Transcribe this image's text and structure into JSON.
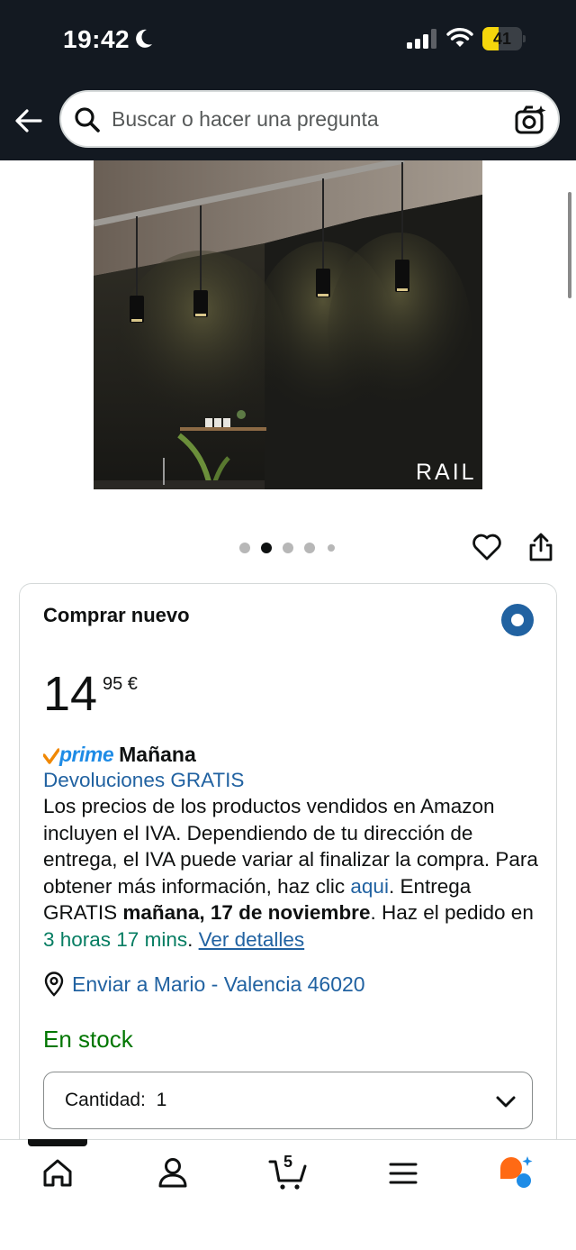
{
  "status_bar": {
    "time": "19:42",
    "battery_level": 41,
    "battery_text": "41",
    "icons": [
      "moon-icon",
      "cellular-signal-icon",
      "wifi-icon",
      "battery-icon"
    ]
  },
  "header": {
    "search_placeholder": "Buscar o hacer una pregunta",
    "icons": [
      "back-arrow-icon",
      "search-icon",
      "camera-search-icon"
    ]
  },
  "product_image": {
    "brand_watermark": "RAIL"
  },
  "gallery": {
    "total_images": 5,
    "active_index": 2
  },
  "buy_box": {
    "title": "Comprar nuevo",
    "price_whole": "14",
    "price_fraction": "95 €",
    "prime_label": "prime",
    "delivery_day": "Mañana",
    "returns_link": "Devoluciones GRATIS",
    "vat_text_1": "Los precios de los productos vendidos en Amazon incluyen el IVA. Dependiendo de tu dirección de entrega, el IVA puede variar al finalizar la compra. Para obtener más información, haz clic ",
    "vat_link": "aqui",
    "vat_text_2": ".",
    "delivery_prefix": "Entrega GRATIS ",
    "delivery_date": "mañana, 17 de noviembre",
    "delivery_middle": ". Haz el pedido en ",
    "countdown": "3 horas 17 mins",
    "delivery_suffix": ". ",
    "details_link": "Ver detalles",
    "location": "Enviar a Mario - Valencia 46020",
    "stock": "En stock",
    "quantity_label": "Cantidad:",
    "quantity_value": "1"
  },
  "bottom_nav": {
    "cart_count": "5",
    "items": [
      "home-icon",
      "account-icon",
      "cart-icon",
      "menu-icon",
      "rufus-assistant-icon"
    ]
  },
  "colors": {
    "header_bg": "#131921",
    "link": "#2162a1",
    "prime_blue": "#1f8ce6",
    "prime_check": "#f08804",
    "in_stock": "#007600",
    "countdown": "#067d62",
    "battery": "#f5d60c"
  }
}
